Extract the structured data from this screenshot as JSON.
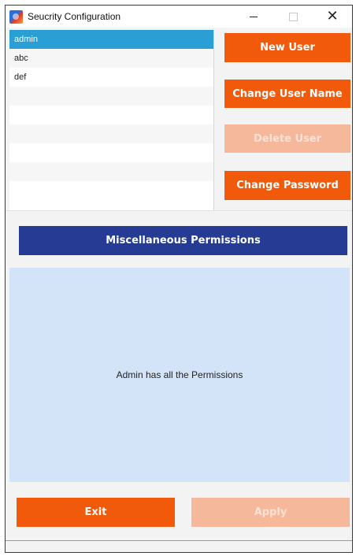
{
  "window": {
    "title": "Seucrity Configuration",
    "minimize_glyph": "–",
    "close_glyph": "✕"
  },
  "users": {
    "items": [
      "admin",
      "abc",
      "def",
      "",
      "",
      "",
      "",
      "",
      ""
    ],
    "selected": "admin"
  },
  "actions": {
    "new_user": "New User",
    "change_user_name": "Change User Name",
    "delete_user": "Delete User",
    "change_password": "Change Password"
  },
  "permissions": {
    "header": "Miscellaneous Permissions",
    "message": "Admin has all the Permissions"
  },
  "footer": {
    "exit": "Exit",
    "apply": "Apply"
  },
  "colors": {
    "accent": "#f15a0b",
    "accent_disabled": "#f5b89a",
    "header_blue": "#253b94",
    "panel_blue": "#d4e4f8",
    "selection": "#2a9fd6"
  },
  "icons": {
    "app": "app-icon",
    "minimize": "minimize-icon",
    "maximize": "maximize-icon",
    "close": "close-icon"
  }
}
